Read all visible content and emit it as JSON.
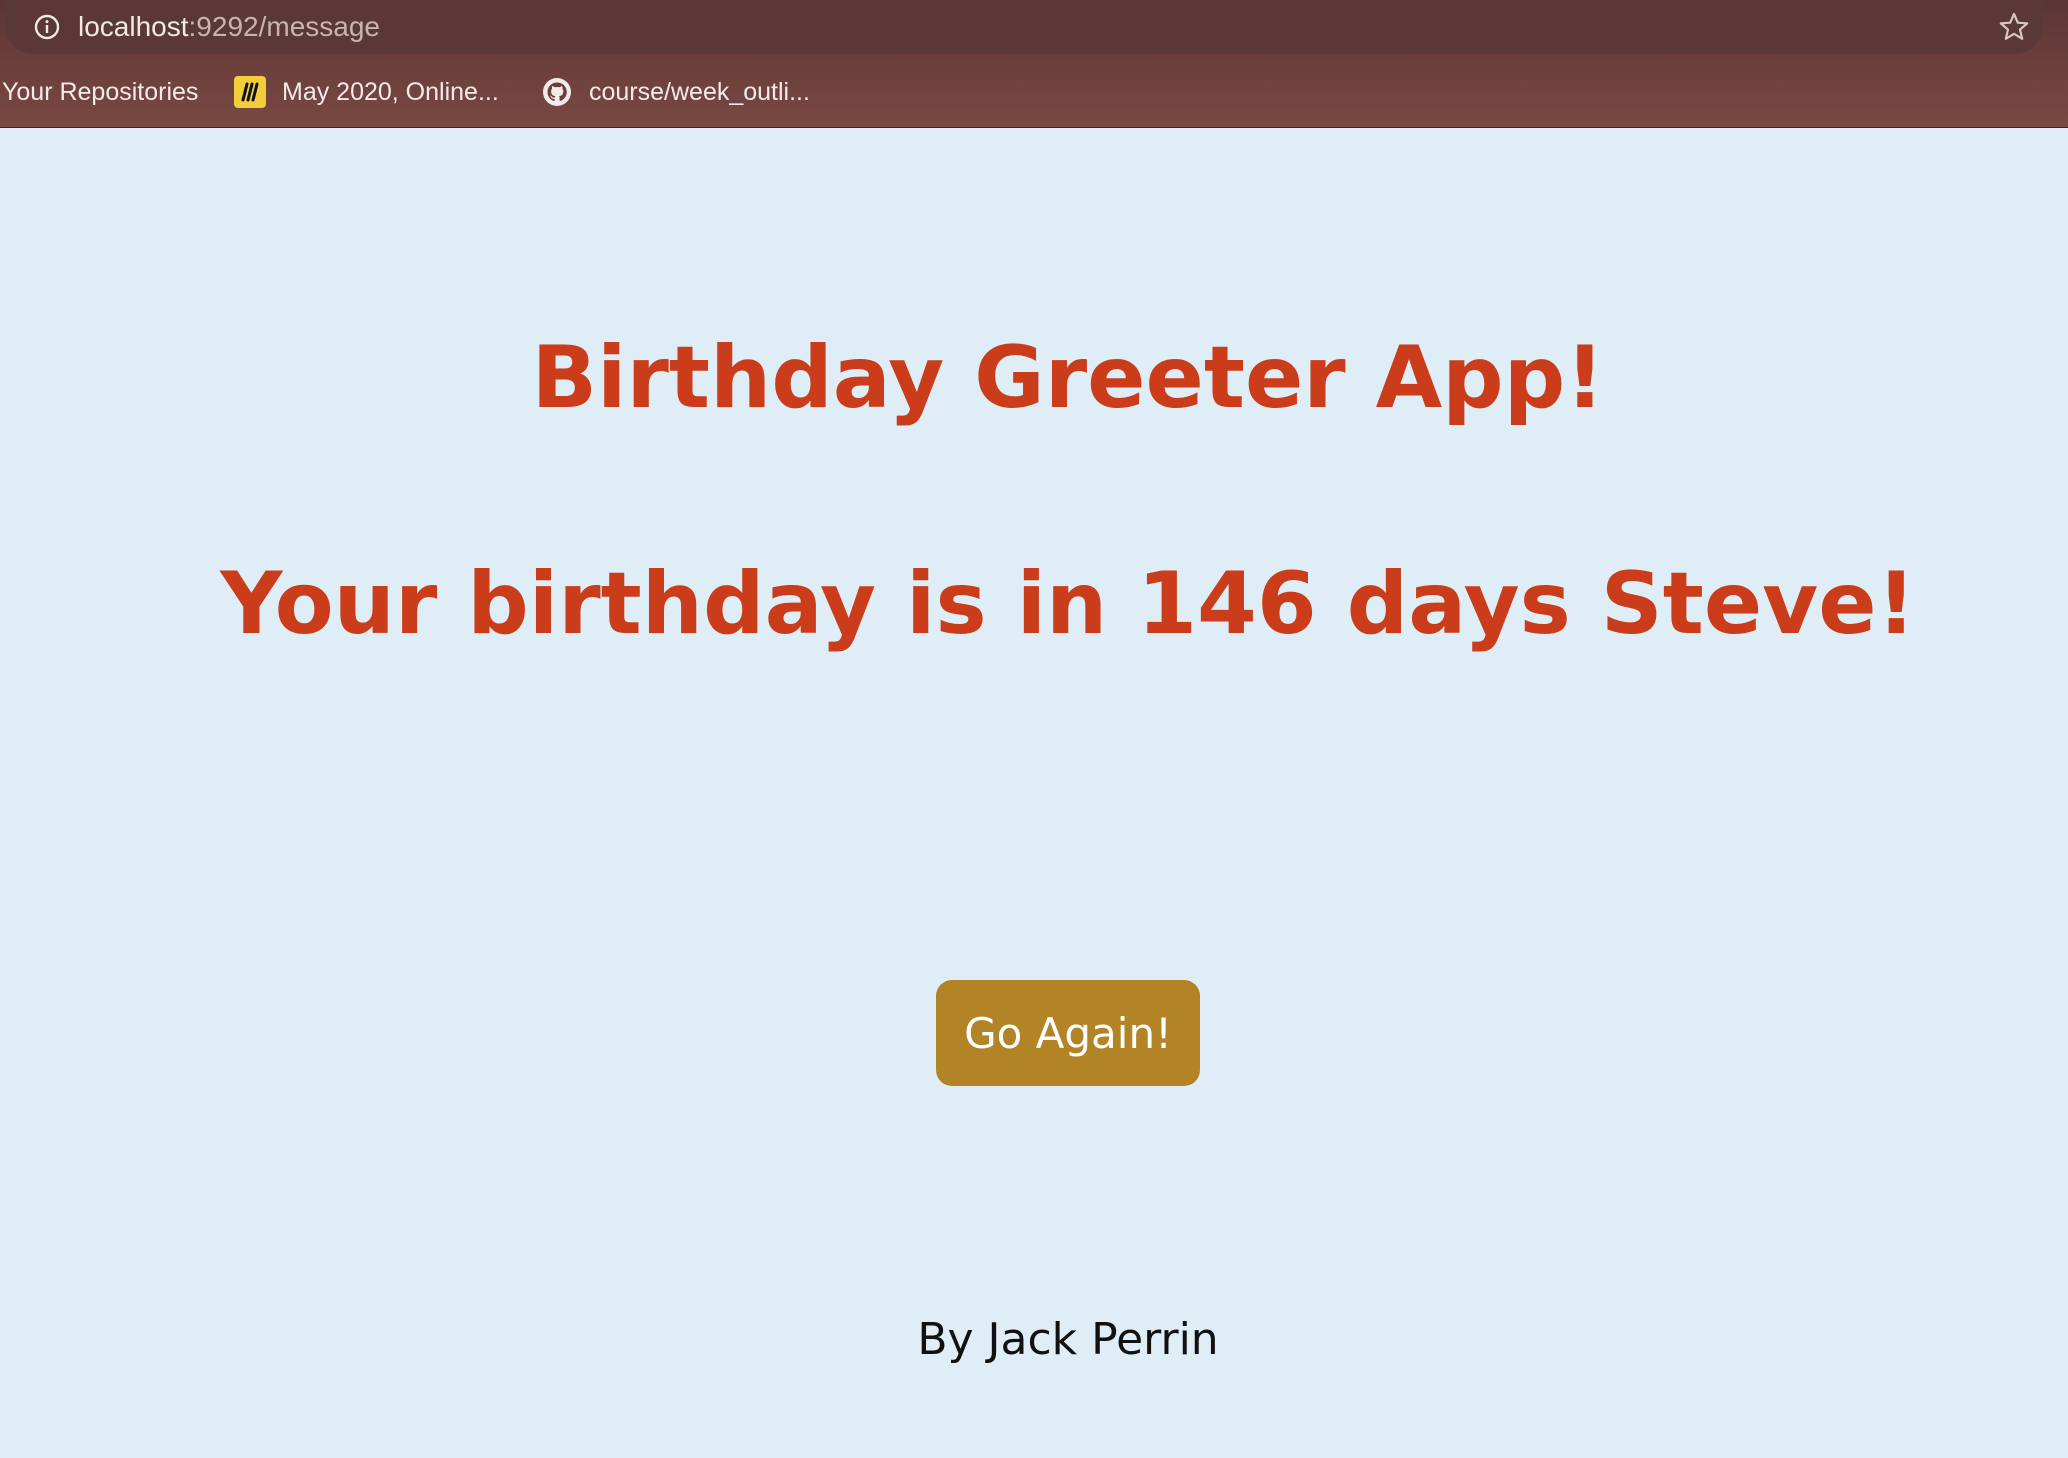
{
  "browser": {
    "url_host": "localhost",
    "url_rest": ":9292/message",
    "bookmarks": [
      {
        "label": "Your Repositories",
        "icon": "none"
      },
      {
        "label": "May 2020, Online...",
        "icon": "miro-icon"
      },
      {
        "label": "course/week_outli...",
        "icon": "github-icon"
      }
    ]
  },
  "page": {
    "title": "Birthday Greeter App!",
    "message": "Your birthday is in 146 days Steve!",
    "button_label": "Go Again!",
    "byline": "By Jack Perrin"
  },
  "colors": {
    "background": "#deedf6",
    "heading": "#cb3d1a",
    "button": "#b38425",
    "chrome": "#5a3838"
  }
}
